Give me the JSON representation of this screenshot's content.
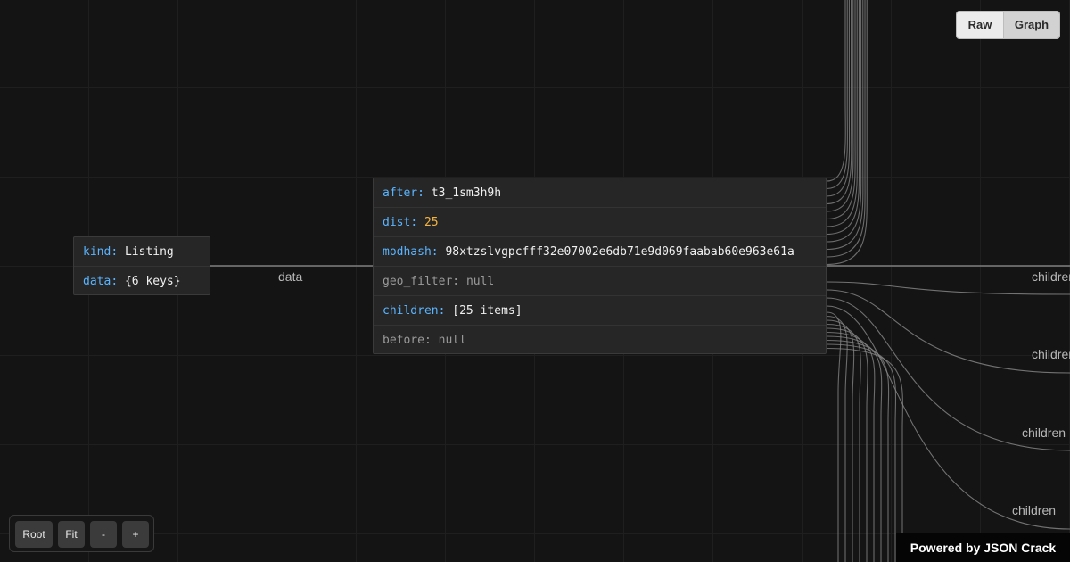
{
  "root_node": {
    "rows": [
      {
        "key": "kind",
        "value": "Listing"
      },
      {
        "key": "data",
        "value": "{6 keys}"
      }
    ]
  },
  "data_node": {
    "rows": [
      {
        "key": "after",
        "value": "t3_1sm3h9h"
      },
      {
        "key": "dist",
        "value": "25"
      },
      {
        "key": "modhash",
        "value": "98xtzslvgpcfff32e07002e6db71e9d069faabab60e963e61a"
      },
      {
        "key": "geo_filter",
        "value": "null"
      },
      {
        "key": "children",
        "value": "[25 items]"
      },
      {
        "key": "before",
        "value": "null"
      }
    ]
  },
  "edge_labels": {
    "data": "data",
    "children": [
      "children",
      "children",
      "children",
      "children"
    ]
  },
  "view_toggle": {
    "raw": "Raw",
    "graph": "Graph",
    "active": "Graph"
  },
  "controls": {
    "root": "Root",
    "fit": "Fit",
    "zoom_out": "-",
    "zoom_in": "+"
  },
  "branding": "Powered by JSON Crack",
  "colors": {
    "background": "#141414",
    "key": "#5ab4ff",
    "number": "#f3b342",
    "null": "#9a9a9a",
    "edge": "#8a8a8a"
  }
}
